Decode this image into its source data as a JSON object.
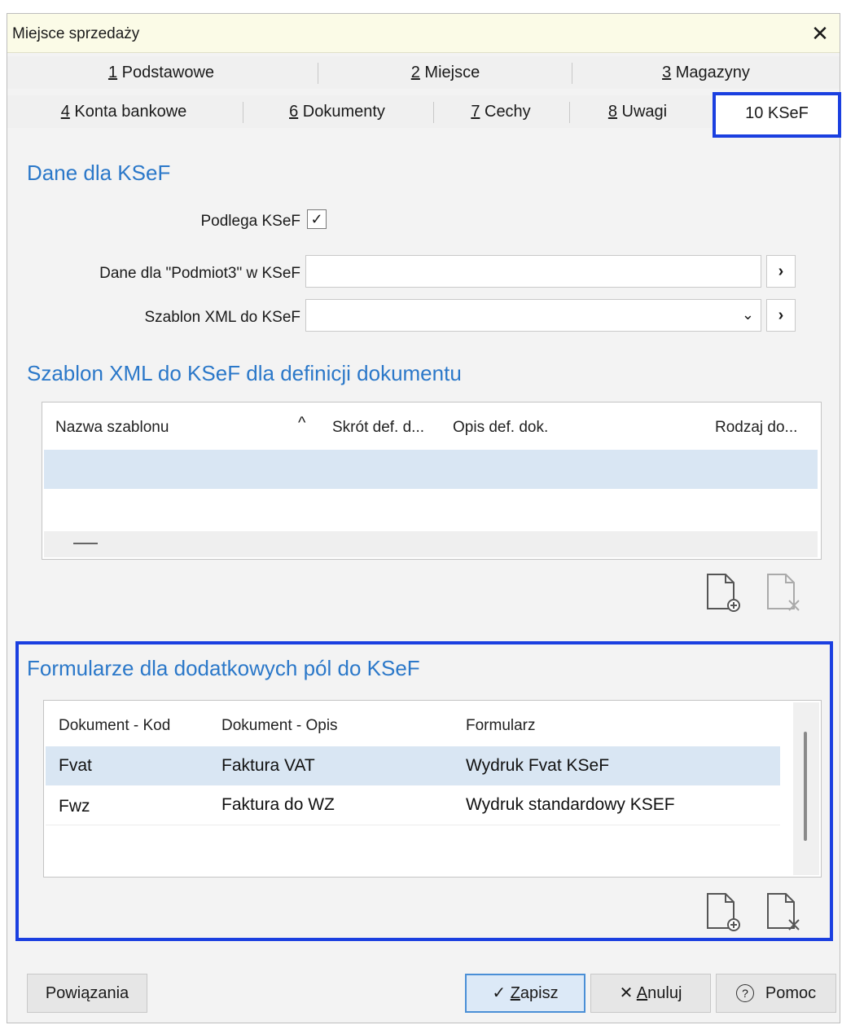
{
  "window": {
    "title": "Miejsce sprzedaży"
  },
  "tabs_row1": [
    {
      "num": "1",
      "label": " Podstawowe"
    },
    {
      "num": "2",
      "label": " Miejsce"
    },
    {
      "num": "3",
      "label": " Magazyny"
    }
  ],
  "tabs_row2": [
    {
      "num": "4",
      "label": " Konta bankowe"
    },
    {
      "num": "6",
      "label": " Dokumenty"
    },
    {
      "num": "7",
      "label": " Cechy"
    },
    {
      "num": "8",
      "label": " Uwagi"
    }
  ],
  "active_tab": {
    "label": "10 KSeF"
  },
  "ksef": {
    "title": "Dane dla KSeF",
    "podlega_label": "Podlega KSeF",
    "podlega_checked": true,
    "podmiot3_label": "Dane dla \"Podmiot3\" w KSeF",
    "podmiot3_value": "",
    "szablon_label": "Szablon XML do KSeF",
    "szablon_value": ""
  },
  "template_grid": {
    "title": "Szablon XML do KSeF dla definicji dokumentu",
    "columns": [
      "Nazwa szablonu",
      "Skrót def. d...",
      "Opis def. dok.",
      "Rodzaj do..."
    ],
    "rows": []
  },
  "forms_grid": {
    "title": "Formularze dla dodatkowych pól do KSeF",
    "columns": [
      "Dokument - Kod",
      "Dokument - Opis",
      "Formularz"
    ],
    "rows": [
      {
        "kod": "Fvat",
        "opis": "Faktura VAT",
        "formularz": "Wydruk Fvat KSeF"
      },
      {
        "kod": "Fwz",
        "opis": "Faktura do WZ",
        "formularz": "Wydruk standardowy KSEF"
      }
    ]
  },
  "footer": {
    "powiazania": "Powiązania",
    "zapisz_icon": "✓",
    "zapisz_accel": "Z",
    "zapisz_rest": "apisz",
    "anuluj_icon": "✕",
    "anuluj_accel": "A",
    "anuluj_rest": "nuluj",
    "pomoc_icon": "?",
    "pomoc": "Pomoc"
  },
  "colors": {
    "accent": "#2b78c9",
    "highlight": "#1a3fe0",
    "selected_row": "#d9e6f3"
  }
}
